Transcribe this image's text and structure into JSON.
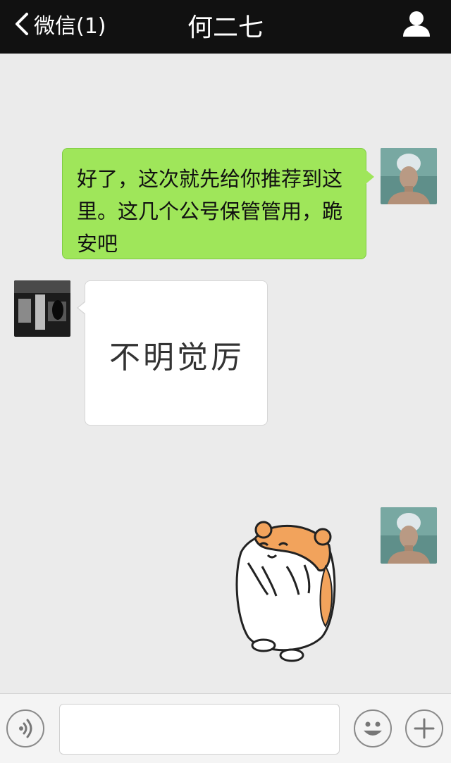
{
  "header": {
    "back_label": "微信(1)",
    "title": "何二七"
  },
  "messages": [
    {
      "side": "right",
      "type": "text",
      "text": "好了，这次就先给你推荐到这里。这几个公号保管管用，跪安吧"
    },
    {
      "side": "left",
      "type": "image",
      "image_text": "不明觉厉"
    },
    {
      "side": "right",
      "type": "sticker",
      "sticker": "hamster-sticker"
    }
  ],
  "input": {
    "placeholder": ""
  },
  "colors": {
    "topbar": "#111111",
    "chat_bg": "#ebebeb",
    "bubble_green": "#9fe65a",
    "bubble_white": "#ffffff"
  },
  "icons": [
    "chevron-left-icon",
    "person-icon",
    "voice-icon",
    "emoji-icon",
    "plus-icon"
  ]
}
